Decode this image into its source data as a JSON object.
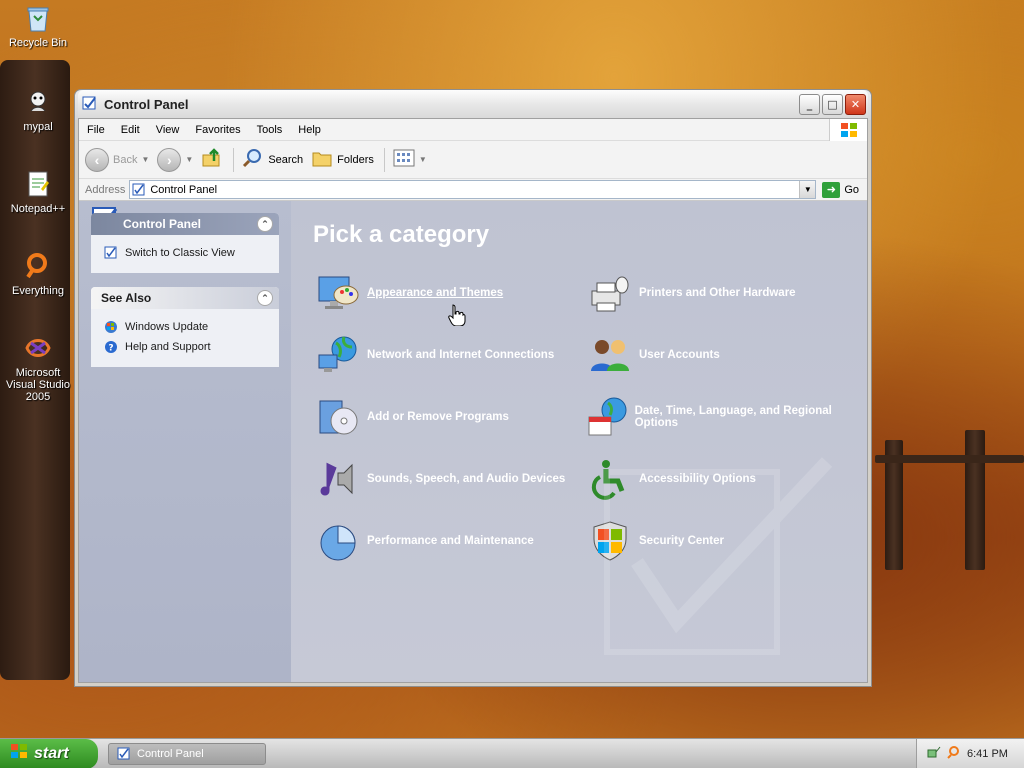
{
  "desktop": {
    "icons": [
      {
        "label": "Recycle Bin"
      },
      {
        "label": "mypal"
      },
      {
        "label": "Notepad++"
      },
      {
        "label": "Everything"
      },
      {
        "label": "Microsoft Visual Studio 2005"
      }
    ]
  },
  "window": {
    "title": "Control Panel",
    "menu": [
      "File",
      "Edit",
      "View",
      "Favorites",
      "Tools",
      "Help"
    ],
    "toolbar": {
      "back": "Back",
      "search": "Search",
      "folders": "Folders"
    },
    "address": {
      "label": "Address",
      "value": "Control Panel",
      "go": "Go"
    }
  },
  "sidebar": {
    "control_panel": {
      "title": "Control Panel",
      "links": [
        "Switch to Classic View"
      ]
    },
    "see_also": {
      "title": "See Also",
      "links": [
        "Windows Update",
        "Help and Support"
      ]
    }
  },
  "main": {
    "heading": "Pick a category",
    "categories": [
      {
        "label": "Appearance and Themes",
        "icon": "appearance-icon"
      },
      {
        "label": "Printers and Other Hardware",
        "icon": "printer-icon"
      },
      {
        "label": "Network and Internet Connections",
        "icon": "network-icon"
      },
      {
        "label": "User Accounts",
        "icon": "users-icon"
      },
      {
        "label": "Add or Remove Programs",
        "icon": "programs-icon"
      },
      {
        "label": "Date, Time, Language, and Regional Options",
        "icon": "datetime-icon"
      },
      {
        "label": "Sounds, Speech, and Audio Devices",
        "icon": "sound-icon"
      },
      {
        "label": "Accessibility Options",
        "icon": "accessibility-icon"
      },
      {
        "label": "Performance and Maintenance",
        "icon": "performance-icon"
      },
      {
        "label": "Security Center",
        "icon": "shield-icon"
      }
    ]
  },
  "taskbar": {
    "start": "start",
    "task": "Control Panel",
    "clock": "6:41 PM"
  }
}
